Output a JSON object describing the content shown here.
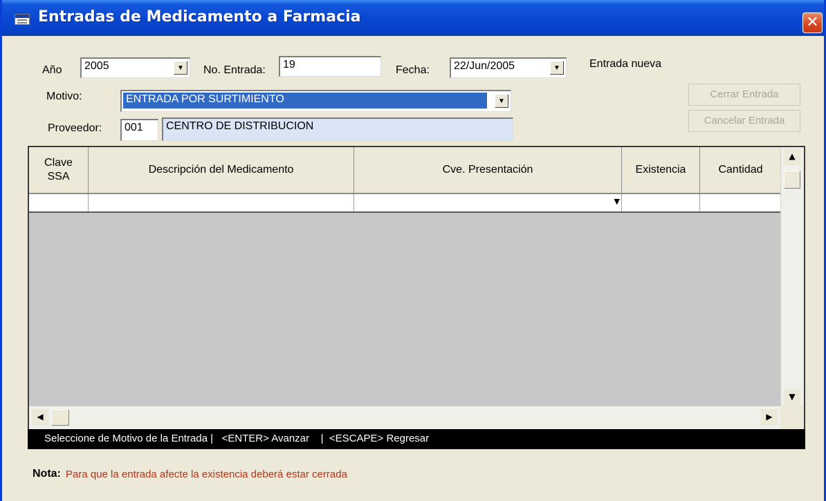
{
  "window": {
    "title": "Entradas de Medicamento a Farmacia",
    "close": "✕"
  },
  "form": {
    "anio_label": "Año",
    "anio_value": "2005",
    "no_entrada_label": "No. Entrada:",
    "no_entrada_value": "19",
    "fecha_label": "Fecha:",
    "fecha_value": "22/Jun/2005",
    "status_text": "Entrada nueva",
    "motivo_label": "Motivo:",
    "motivo_value": "ENTRADA POR SURTIMIENTO",
    "proveedor_label": "Proveedor:",
    "proveedor_code": "001",
    "proveedor_name": "CENTRO DE DISTRIBUCION"
  },
  "buttons": {
    "cerrar": "Cerrar Entrada",
    "cancelar": "Cancelar Entrada"
  },
  "grid": {
    "headers": {
      "clave_line1": "Clave",
      "clave_line2": "SSA",
      "descripcion": "Descripción del Medicamento",
      "presentacion": "Cve. Presentación",
      "existencia": "Existencia",
      "cantidad": "Cantidad"
    }
  },
  "statusbar": "Seleccione de Motivo de la Entrada |   <ENTER> Avanzar    |  <ESCAPE> Regresar",
  "nota": {
    "label": "Nota:",
    "text": "Para que la entrada afecte la existencia deberá estar cerrada"
  },
  "icons": {
    "dropdown": "▼",
    "arrow_up": "▲",
    "arrow_down": "▼",
    "arrow_left": "◀",
    "arrow_right": "▶"
  },
  "colors": {
    "title_bar": "#0a48d2",
    "selection": "#316ac5",
    "readonly_field": "#d9e4f5",
    "note_text": "#b3331a"
  }
}
